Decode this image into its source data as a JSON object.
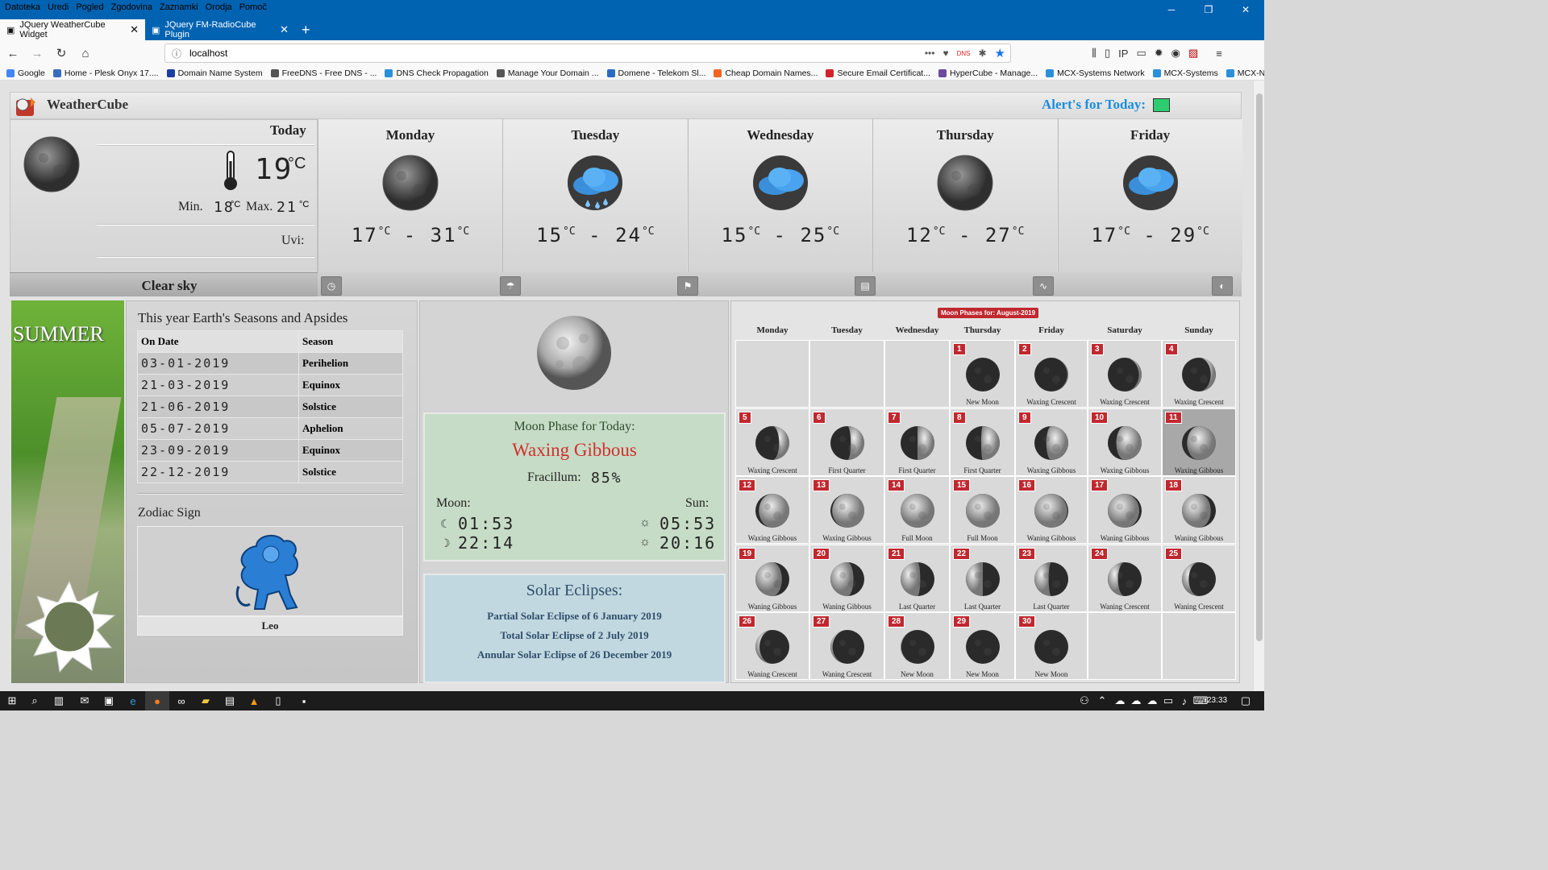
{
  "menu": [
    "Datoteka",
    "Uredi",
    "Pogled",
    "Zgodovina",
    "Zaznamki",
    "Orodja",
    "Pomoč"
  ],
  "tabs": [
    {
      "title": "JQuery WeatherCube Widget"
    },
    {
      "title": "JQuery FM-RadioCube Plugin"
    }
  ],
  "address": {
    "url": "localhost",
    "dns_badge": "DNS"
  },
  "bookmarks": [
    {
      "label": "Google",
      "color": "#4285f4"
    },
    {
      "label": "Home - Plesk Onyx 17....",
      "color": "#3b6dbf"
    },
    {
      "label": "Domain Name System",
      "color": "#1b3fa0"
    },
    {
      "label": "FreeDNS - Free DNS - ...",
      "color": "#555555"
    },
    {
      "label": "DNS Check Propagation",
      "color": "#2a90d8"
    },
    {
      "label": "Manage Your Domain ...",
      "color": "#555555"
    },
    {
      "label": "Domene - Telekom Sl...",
      "color": "#2a6bc4"
    },
    {
      "label": "Cheap Domain Names...",
      "color": "#f26522"
    },
    {
      "label": "Secure Email Certificat...",
      "color": "#d2232a"
    },
    {
      "label": "HyperCube - Manage...",
      "color": "#6a4ba0"
    },
    {
      "label": "MCX-Systems Network",
      "color": "#2a90d8"
    },
    {
      "label": "MCX-Systems",
      "color": "#2a90d8"
    },
    {
      "label": "MCX-Network",
      "color": "#2a90d8"
    }
  ],
  "widget": {
    "title": "WeatherCube",
    "alerts_label": "Alert's for Today:",
    "alert_color": "#2ecc71",
    "today": {
      "label": "Today",
      "temp": "19",
      "unit": "°C",
      "min_label": "Min.",
      "min": "18",
      "max_label": "Max.",
      "max": "21",
      "uvi_label": "Uvi:",
      "condition": "Clear sky"
    },
    "forecast": [
      {
        "day": "Monday",
        "low": "17",
        "high": "31",
        "icon": "moon-icon"
      },
      {
        "day": "Tuesday",
        "low": "15",
        "high": "24",
        "icon": "rain-cloud-icon"
      },
      {
        "day": "Wednesday",
        "low": "15",
        "high": "25",
        "icon": "cloud-icon"
      },
      {
        "day": "Thursday",
        "low": "12",
        "high": "27",
        "icon": "moon-icon"
      },
      {
        "day": "Friday",
        "low": "17",
        "high": "29",
        "icon": "cloud-icon"
      }
    ],
    "unit": "°C",
    "toolbar_icons": [
      "clock-icon",
      "umbrella-icon",
      "flag-icon",
      "document-icon",
      "pulse-icon",
      "half-circle-icon"
    ]
  },
  "season": {
    "name": "SUMMER"
  },
  "apsides": {
    "title": "This year Earth's Seasons and Apsides",
    "headers": [
      "On Date",
      "Season"
    ],
    "rows": [
      {
        "date": "03-01-2019",
        "season": "Perihelion"
      },
      {
        "date": "21-03-2019",
        "season": "Equinox"
      },
      {
        "date": "21-06-2019",
        "season": "Solstice"
      },
      {
        "date": "05-07-2019",
        "season": "Aphelion"
      },
      {
        "date": "23-09-2019",
        "season": "Equinox"
      },
      {
        "date": "22-12-2019",
        "season": "Solstice"
      }
    ]
  },
  "zodiac": {
    "title": "Zodiac Sign",
    "sign": "Leo"
  },
  "moon": {
    "title": "Moon Phase for Today:",
    "phase": "Waxing Gibbous",
    "fracillum_label": "Fracillum:",
    "fracillum": "85%",
    "moon_label": "Moon:",
    "sun_label": "Sun:",
    "moonrise": "01:53",
    "moonset": "22:14",
    "sunrise": "05:53",
    "sunset": "20:16"
  },
  "eclipses": {
    "title": "Solar Eclipses:",
    "items": [
      "Partial Solar Eclipse of 6 January 2019",
      "Total Solar Eclipse of 2 July 2019",
      "Annular Solar Eclipse of 26 December 2019"
    ]
  },
  "calendar": {
    "title": "Moon Phases for: August-2019",
    "weekdays": [
      "Monday",
      "Tuesday",
      "Wednesday",
      "Thursday",
      "Friday",
      "Saturday",
      "Sunday"
    ],
    "first_weekday_index": 3,
    "today": 11,
    "days": [
      {
        "d": "1",
        "phase": "New Moon",
        "illum": 0.0
      },
      {
        "d": "2",
        "phase": "Waxing Crescent",
        "illum": 0.03
      },
      {
        "d": "3",
        "phase": "Waxing Crescent",
        "illum": 0.08
      },
      {
        "d": "4",
        "phase": "Waxing Crescent",
        "illum": 0.15
      },
      {
        "d": "5",
        "phase": "Waxing Crescent",
        "illum": 0.3
      },
      {
        "d": "6",
        "phase": "First Quarter",
        "illum": 0.4
      },
      {
        "d": "7",
        "phase": "First Quarter",
        "illum": 0.5
      },
      {
        "d": "8",
        "phase": "First Quarter",
        "illum": 0.55
      },
      {
        "d": "9",
        "phase": "Waxing Gibbous",
        "illum": 0.65
      },
      {
        "d": "10",
        "phase": "Waxing Gibbous",
        "illum": 0.75
      },
      {
        "d": "11",
        "phase": "Waxing Gibbous",
        "illum": 0.85
      },
      {
        "d": "12",
        "phase": "Waxing Gibbous",
        "illum": 0.9
      },
      {
        "d": "13",
        "phase": "Waxing Gibbous",
        "illum": 0.95
      },
      {
        "d": "14",
        "phase": "Full Moon",
        "illum": 1.0
      },
      {
        "d": "15",
        "phase": "Full Moon",
        "illum": 1.0
      },
      {
        "d": "16",
        "phase": "Waning Gibbous",
        "illum": -0.97
      },
      {
        "d": "17",
        "phase": "Waning Gibbous",
        "illum": -0.93
      },
      {
        "d": "18",
        "phase": "Waning Gibbous",
        "illum": -0.85
      },
      {
        "d": "19",
        "phase": "Waning Gibbous",
        "illum": -0.78
      },
      {
        "d": "20",
        "phase": "Waning Gibbous",
        "illum": -0.68
      },
      {
        "d": "21",
        "phase": "Last Quarter",
        "illum": -0.58
      },
      {
        "d": "22",
        "phase": "Last Quarter",
        "illum": -0.5
      },
      {
        "d": "23",
        "phase": "Last Quarter",
        "illum": -0.42
      },
      {
        "d": "24",
        "phase": "Waning Crescent",
        "illum": -0.3
      },
      {
        "d": "25",
        "phase": "Waning Crescent",
        "illum": -0.2
      },
      {
        "d": "26",
        "phase": "Waning Crescent",
        "illum": -0.12
      },
      {
        "d": "27",
        "phase": "Waning Crescent",
        "illum": -0.06
      },
      {
        "d": "28",
        "phase": "New Moon",
        "illum": -0.02
      },
      {
        "d": "29",
        "phase": "New Moon",
        "illum": 0.0
      },
      {
        "d": "30",
        "phase": "New Moon",
        "illum": 0.0
      }
    ]
  },
  "taskbar": {
    "time": "23:33"
  }
}
